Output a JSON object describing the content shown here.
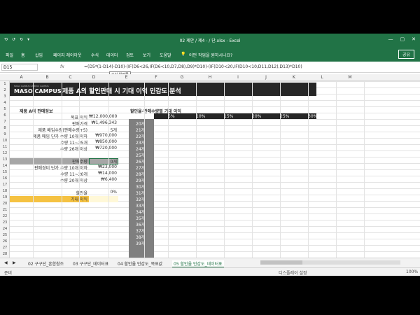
{
  "titlebar": {
    "title": "02 제안 / 제4 - / 단.xlsx - Excel",
    "qa": [
      "⟲",
      "↺",
      "↻",
      "▾"
    ],
    "window": [
      "—",
      "▢",
      "✕"
    ]
  },
  "tabs": [
    "파일",
    "홈",
    "삽입",
    "페이지 레이아웃",
    "수식",
    "데이터",
    "검토",
    "보기",
    "도움말"
  ],
  "search_placeholder": "어떤 작업을 원하시나요?",
  "share_label": "공유",
  "formula_bar": {
    "name_box": "D15",
    "fx": "fx",
    "formula": "=(D5*(1-D14)-D10)-(IF(D6<26,IF(D6<10,D7,D8),D9)*D10)-(IF(D10<20,IF(D10<10,D11,D12),D13)*D10)",
    "tooltip": "수식 입력줄"
  },
  "columns": [
    "A",
    "B",
    "C",
    "D",
    "E",
    "F",
    "G",
    "H",
    "I",
    "J",
    "K",
    "L",
    "M"
  ],
  "rows": [
    "1",
    "2",
    "3",
    "4",
    "5",
    "6",
    "7",
    "8",
    "9",
    "10",
    "11",
    "12",
    "13",
    "14",
    "15",
    "16",
    "17",
    "18",
    "19",
    "20",
    "21",
    "22",
    "23",
    "24",
    "25",
    "26",
    "27",
    "28"
  ],
  "banner": {
    "logo_small": "MASO CAMPUS CAMPUS CAMPUS",
    "logo": "MASO CAMPUS",
    "title": "제품 A의 할인판매 시 기대 이익 민감도 분석"
  },
  "left_table": {
    "heading": "제품 A의 판매정보",
    "rows": [
      {
        "label": "목표 이익",
        "value": "₩12,000,000"
      },
      {
        "label": "판매가격",
        "value": "₩1,496,343"
      },
      {
        "label": "제품 배입수량(판매수량+5)",
        "value": "5개"
      },
      {
        "label": "제품 매입 단가  수량 10개 이하",
        "value": "₩970,000"
      },
      {
        "label": "수량 11~25개",
        "value": "₩850,000"
      },
      {
        "label": "수량 26개 이상",
        "value": "₩720,000"
      },
      {
        "label": "판매수량",
        "value": "0개"
      },
      {
        "label": "판매경비 단가  수량 10개 이하",
        "value": "₩23,000"
      },
      {
        "label": "수량 11~20개",
        "value": "₩14,000"
      },
      {
        "label": "수량 20개 이상",
        "value": "₩6,400"
      },
      {
        "label": "할인율",
        "value": "0%"
      },
      {
        "label": "기대 이익",
        "value": ""
      }
    ]
  },
  "right_table": {
    "heading": "할인율-판매수량별 기대 이익",
    "rates": [
      "5%",
      "10%",
      "15%",
      "20%",
      "25%",
      "30%"
    ],
    "years": [
      "20개",
      "21개",
      "22개",
      "23개",
      "24개",
      "25개",
      "26개",
      "27개",
      "28개",
      "29개",
      "30개",
      "31개",
      "32개",
      "33개",
      "34개",
      "35개",
      "36개",
      "37개",
      "38개",
      "39개"
    ]
  },
  "sheet_tabs": [
    "◀",
    "▶",
    "02 구구단_혼합참조",
    "03 구구단_데이터표",
    "04 할인율 민감도_목표값",
    "05 할인율 민감도_데이터표"
  ],
  "status": {
    "left": "준비",
    "right": "디스플레이 설정",
    "zoom": "100%"
  }
}
